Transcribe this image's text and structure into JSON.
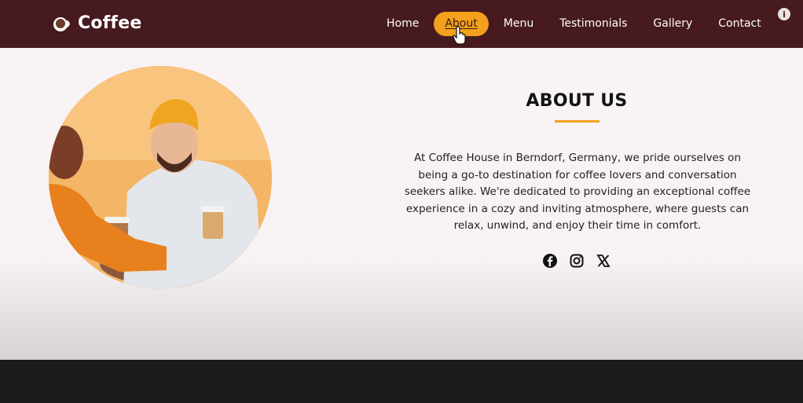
{
  "brand": {
    "name": "Coffee",
    "icon": "coffee-cup-icon",
    "color": "#ffffff"
  },
  "nav": {
    "items": [
      {
        "label": "Home"
      },
      {
        "label": "About",
        "active": true
      },
      {
        "label": "Menu"
      },
      {
        "label": "Testimonials"
      },
      {
        "label": "Gallery"
      },
      {
        "label": "Contact"
      }
    ],
    "info_icon": "i"
  },
  "about": {
    "title": "ABOUT US",
    "text": "At Coffee House in Berndorf, Germany, we pride ourselves on being a go-to destination for coffee lovers and conversation seekers alike. We're dedicated to providing an exceptional coffee experience in a cozy and inviting atmosphere, where guests can relax, unwind, and enjoy their time in comfort.",
    "image": "two people laughing with coffee cups",
    "social": [
      "facebook-icon",
      "instagram-icon",
      "x-icon"
    ]
  },
  "colors": {
    "header": "#461a1e",
    "accent": "#f3a11d",
    "section_bg": "#f9f3f5",
    "footer": "#1b1b1b"
  }
}
